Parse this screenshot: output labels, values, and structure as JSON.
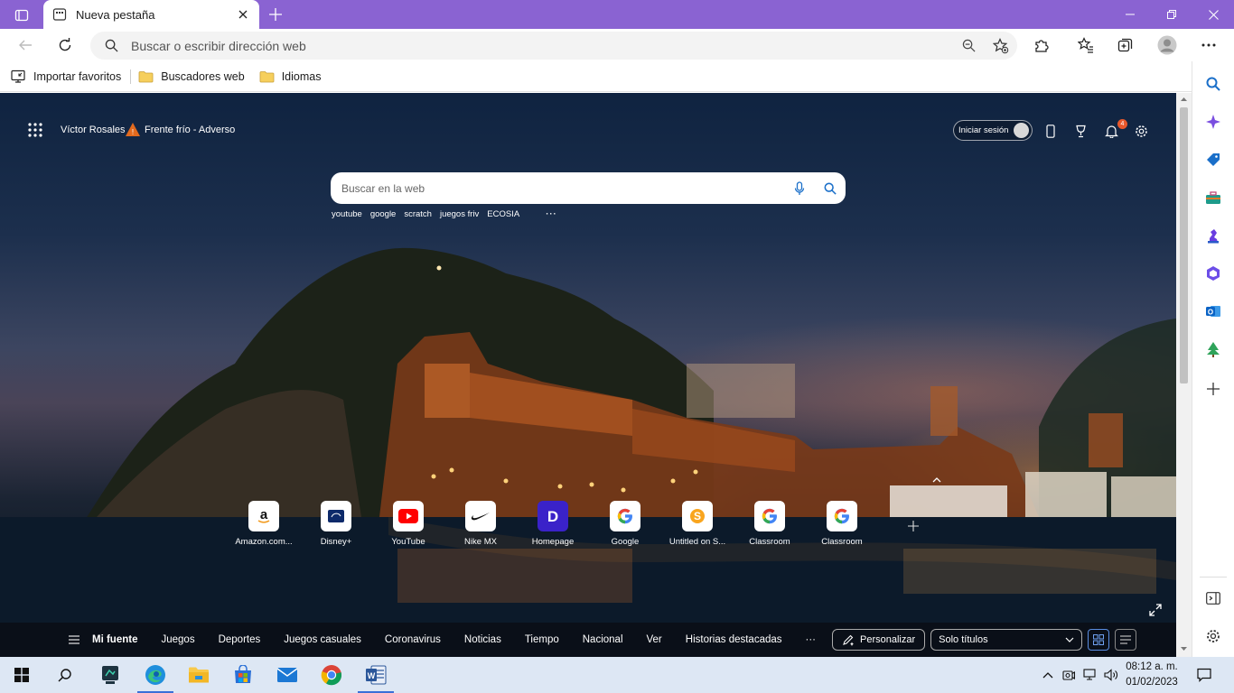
{
  "browser": {
    "tab_title": "Nueva pestaña",
    "address_placeholder": "Buscar o escribir dirección web",
    "favorites": [
      {
        "label": "Importar favoritos",
        "icon": "import-icon"
      },
      {
        "label": "Buscadores web",
        "icon": "folder-icon"
      },
      {
        "label": "Idiomas",
        "icon": "folder-icon"
      }
    ]
  },
  "newtab": {
    "user_name": "Víctor Rosales",
    "weather_text": "Frente frío - Adverso",
    "signin_label": "Iniciar sesión",
    "notification_count": "4",
    "search_placeholder": "Buscar en la web",
    "suggestions": [
      "youtube",
      "google",
      "scratch",
      "juegos friv",
      "ECOSIA"
    ],
    "suggestions_more": "···",
    "quick_links": [
      {
        "label": "Amazon.com...",
        "icon": "amazon-icon"
      },
      {
        "label": "Disney+",
        "icon": "disney-icon"
      },
      {
        "label": "YouTube",
        "icon": "youtube-icon"
      },
      {
        "label": "Nike MX",
        "icon": "nike-icon"
      },
      {
        "label": "Homepage",
        "icon": "homepage-d-icon"
      },
      {
        "label": "Google",
        "icon": "google-icon"
      },
      {
        "label": "Untitled on S...",
        "icon": "scratch-s-icon"
      },
      {
        "label": "Classroom",
        "icon": "google-icon"
      },
      {
        "label": "Classroom",
        "icon": "google-icon"
      }
    ],
    "feed": {
      "items": [
        "Mi fuente",
        "Juegos",
        "Deportes",
        "Juegos casuales",
        "Coronavirus",
        "Noticias",
        "Tiempo",
        "Nacional",
        "Ver",
        "Historias destacadas"
      ],
      "more": "···",
      "personalize_label": "Personalizar",
      "layout_select": "Solo títulos"
    }
  },
  "taskbar": {
    "time": "08:12 a. m.",
    "date": "01/02/2023"
  },
  "colors": {
    "titlebar": "#8a63d2",
    "taskbar": "#dde7f4",
    "accent": "#3a6fd8"
  }
}
